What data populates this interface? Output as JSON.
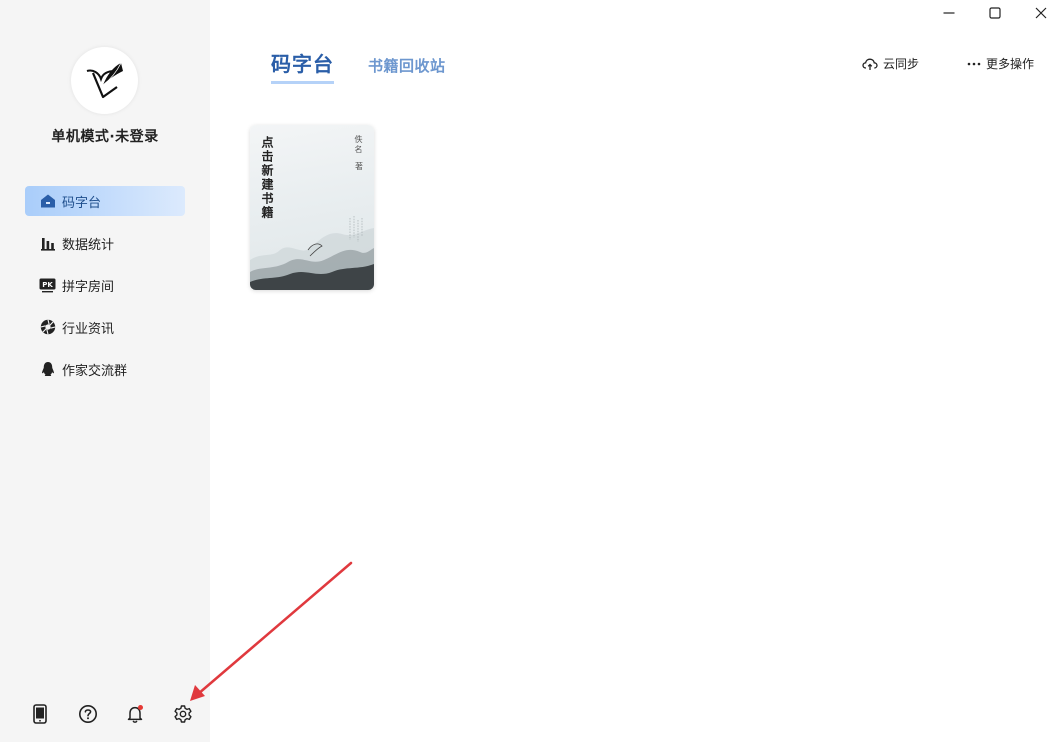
{
  "window": {
    "minimize_icon": "minimize-icon",
    "maximize_icon": "maximize-icon",
    "close_icon": "close-icon"
  },
  "sidebar": {
    "user_status": "单机模式·未登录",
    "items": [
      {
        "label": "码字台",
        "icon": "home-icon",
        "active": true
      },
      {
        "label": "数据统计",
        "icon": "bar-chart-icon",
        "active": false
      },
      {
        "label": "拼字房间",
        "icon": "pk-icon",
        "active": false
      },
      {
        "label": "行业资讯",
        "icon": "aperture-icon",
        "active": false
      },
      {
        "label": "作家交流群",
        "icon": "penguin-icon",
        "active": false
      }
    ],
    "bottom_icons": [
      "tablet-icon",
      "help-icon",
      "bell-icon",
      "gear-icon"
    ]
  },
  "tabs": {
    "main": "码字台",
    "secondary": "书籍回收站"
  },
  "actions": {
    "cloud_sync": "云同步",
    "more": "更多操作"
  },
  "book": {
    "title": "点击新建书籍",
    "author": "佚名",
    "author_suffix": "著"
  },
  "colors": {
    "accent": "#2a5ea8",
    "active_nav": "#a9cdfa",
    "sidebar_bg": "#f5f5f5",
    "annotation_arrow": "#e0393e",
    "notification_dot": "#e53935"
  }
}
